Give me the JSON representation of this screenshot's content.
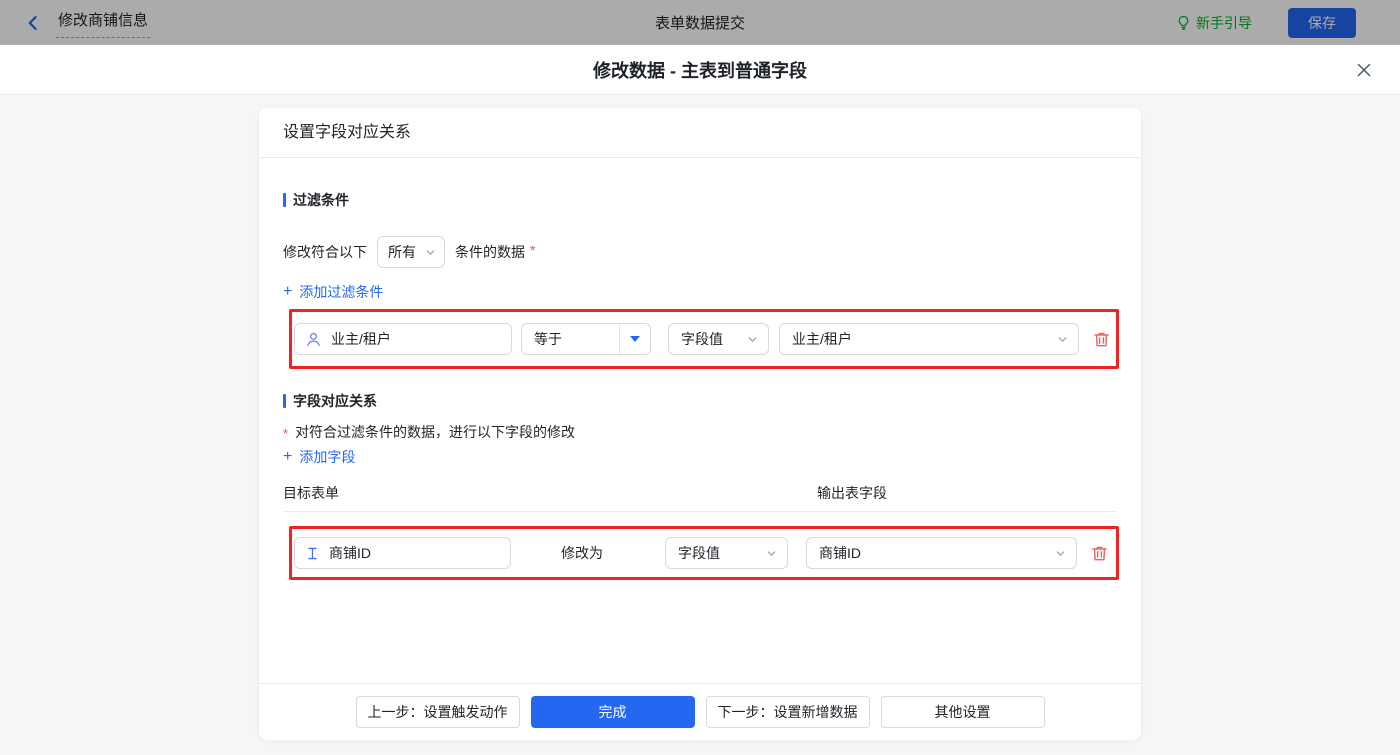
{
  "colors": {
    "primary_blue": "#2468f2",
    "link_blue": "#2468f2",
    "annotation_red": "#ee2424",
    "danger_red": "#e34d59",
    "trash_red": "#f06060",
    "guide_green": "#00b42a"
  },
  "icons": {
    "back": "chevron-left-icon",
    "guide": "lightbulb-icon",
    "close": "close-icon",
    "filter_field": "person-icon",
    "mapping_field": "text-cursor-icon",
    "operator": "caret-down-icon",
    "select": "chevron-down-icon",
    "delete": "trash-icon"
  },
  "topbar": {
    "back_title": "修改商铺信息",
    "center_title": "表单数据提交",
    "guide_label": "新手引导",
    "save_label": "保存"
  },
  "modal": {
    "title": "修改数据 - 主表到普通字段"
  },
  "panel": {
    "header_title": "设置字段对应关系",
    "filter": {
      "section_title": "过滤条件",
      "condition_prefix": "修改符合以下",
      "condition_select_value": "所有",
      "condition_suffix": "条件的数据",
      "required_mark": "*",
      "add_plus": "+",
      "add_label": "添加过滤条件",
      "row": {
        "field": "业主/租户",
        "operator": "等于",
        "value_type": "字段值",
        "value": "业主/租户"
      }
    },
    "mapping": {
      "section_title": "字段对应关系",
      "required_mark": "*",
      "description": "对符合过滤条件的数据，进行以下字段的修改",
      "add_plus": "+",
      "add_label": "添加字段",
      "column_target": "目标表单",
      "column_output": "输出表字段",
      "row": {
        "field": "商铺ID",
        "action_label": "修改为",
        "value_type": "字段值",
        "value": "商铺ID"
      }
    },
    "footer": {
      "prev_label": "上一步：设置触发动作",
      "done_label": "完成",
      "next_label": "下一步：设置新增数据",
      "other_label": "其他设置"
    }
  }
}
